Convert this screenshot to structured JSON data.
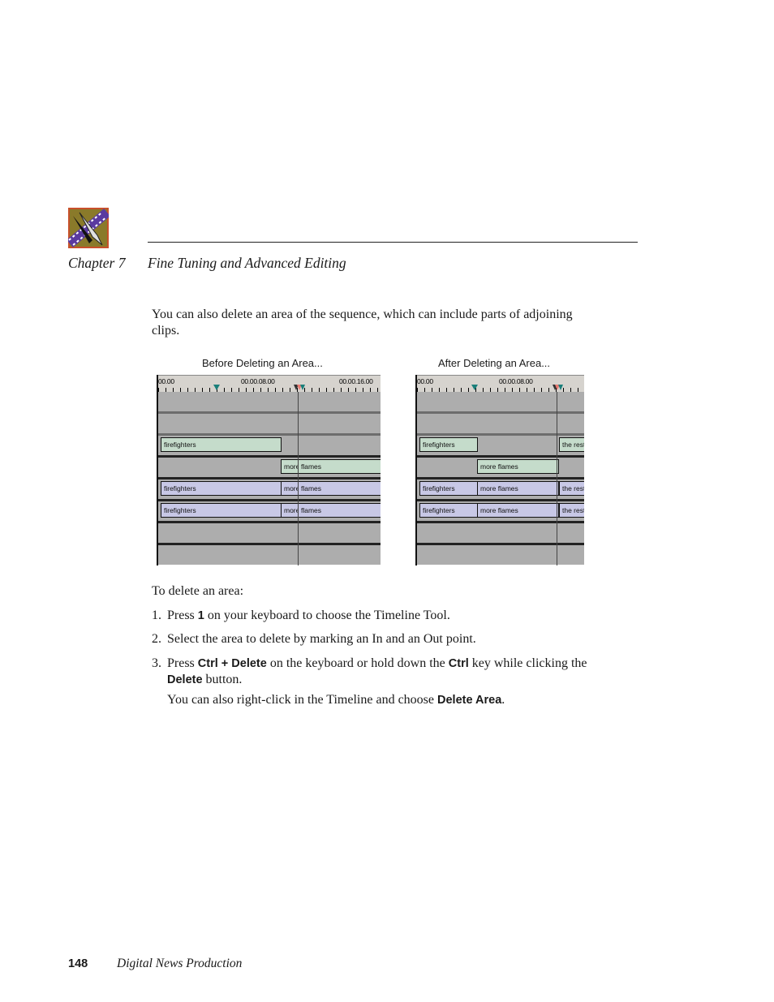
{
  "header": {
    "logo_icon": "film-strip-scissors-logo",
    "chapter_label": "Chapter 7",
    "chapter_title": "Fine Tuning and Advanced Editing"
  },
  "intro": "You can also delete an area of the sequence, which can include parts of adjoining clips.",
  "figures": {
    "before": {
      "caption": "Before Deleting an Area...",
      "ruler": [
        "00.00",
        "00.00.08.00",
        "00.00.16.00"
      ],
      "tracks": [
        {
          "clips": []
        },
        {
          "clips": []
        },
        {
          "clips": [
            {
              "label": "firefighters",
              "color": "green"
            }
          ]
        },
        {
          "clips": [
            {
              "label": "more",
              "color": "green"
            },
            {
              "label": "flames",
              "color": "green"
            }
          ]
        },
        {
          "clips": [
            {
              "label": "firefighters",
              "color": "blue"
            },
            {
              "label": "more",
              "color": "blue"
            },
            {
              "label": "flames",
              "color": "blue"
            }
          ]
        },
        {
          "clips": [
            {
              "label": "firefighters",
              "color": "blue"
            },
            {
              "label": "more",
              "color": "blue"
            },
            {
              "label": "flames",
              "color": "blue"
            }
          ]
        },
        {
          "clips": []
        },
        {
          "clips": []
        }
      ]
    },
    "after": {
      "caption": "After Deleting an Area...",
      "ruler": [
        "00.00",
        "00.00.08.00"
      ],
      "tracks": [
        {
          "clips": []
        },
        {
          "clips": []
        },
        {
          "clips": [
            {
              "label": "firefighters",
              "color": "green"
            },
            {
              "label": "the rest",
              "color": "green"
            }
          ]
        },
        {
          "clips": [
            {
              "label": "more flames",
              "color": "green"
            }
          ]
        },
        {
          "clips": [
            {
              "label": "firefighters",
              "color": "blue"
            },
            {
              "label": "more flames",
              "color": "blue"
            },
            {
              "label": "the rest",
              "color": "blue"
            }
          ]
        },
        {
          "clips": [
            {
              "label": "firefighters",
              "color": "blue"
            },
            {
              "label": "more flames",
              "color": "blue"
            },
            {
              "label": "the rest",
              "color": "blue"
            }
          ]
        },
        {
          "clips": []
        },
        {
          "clips": []
        }
      ]
    },
    "colors": {
      "green_clip": "#c5dccb",
      "blue_clip": "#c8c8e6",
      "track_bg": "#adadad",
      "ruler_bg": "#d6d3ce",
      "in_marker": "#1a7f7a",
      "out_marker": "#e87a72"
    }
  },
  "procedure": {
    "lead": "To delete an area:",
    "steps": [
      {
        "num": "1.",
        "pre": "Press ",
        "key": "1",
        "post": " on your keyboard to choose the Timeline Tool."
      },
      {
        "num": "2.",
        "text": "Select the area to delete by marking an In and an Out point."
      },
      {
        "num": "3.",
        "pre": "Press ",
        "key1": "Ctrl + Delete",
        "mid": " on the keyboard or hold down the ",
        "key2": "Ctrl",
        "mid2": " key while clicking the ",
        "key3": "Delete",
        "post": " button."
      }
    ],
    "note_pre": "You can also right-click in the Timeline and choose ",
    "note_key": "Delete Area",
    "note_post": "."
  },
  "footer": {
    "page_number": "148",
    "book_title": "Digital News Production"
  }
}
